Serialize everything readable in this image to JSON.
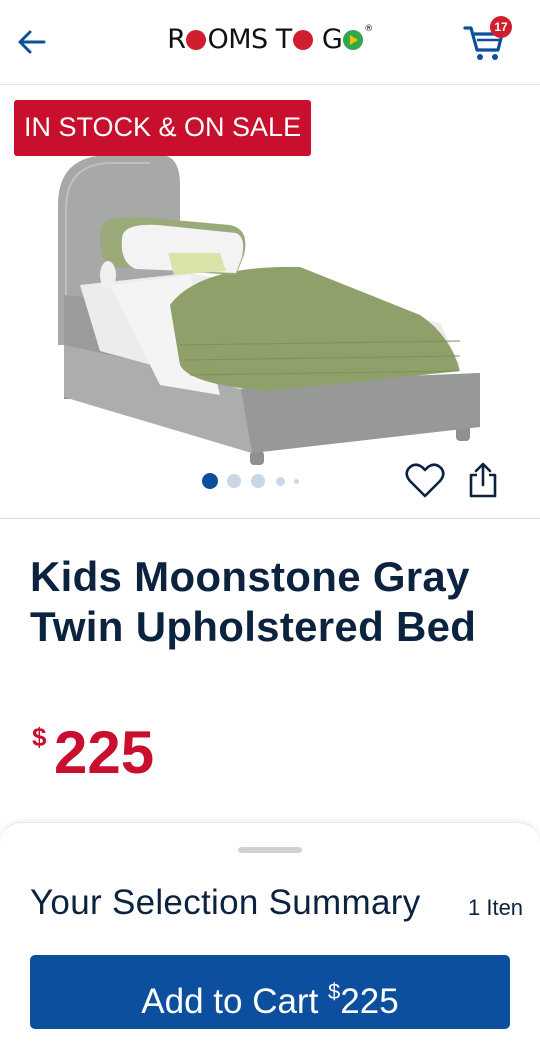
{
  "header": {
    "logo_text_1": "R",
    "logo_text_2": "OMS T",
    "logo_text_3": "G",
    "cart_count": "17"
  },
  "product": {
    "badge": "IN STOCK & ON SALE",
    "title": "Kids Moonstone Gray Twin Upholstered Bed",
    "price_currency": "$",
    "price_amount": "225",
    "gallery_dots": 5,
    "gallery_active_index": 0
  },
  "summary": {
    "title": "Your Selection Summary",
    "count": "1 Iten",
    "add_label": "Add to Cart ",
    "add_currency": "$",
    "add_amount": "225"
  },
  "colors": {
    "brand_blue": "#0b4f9e",
    "sale_red": "#c8102e",
    "navy_text": "#0c2340"
  }
}
